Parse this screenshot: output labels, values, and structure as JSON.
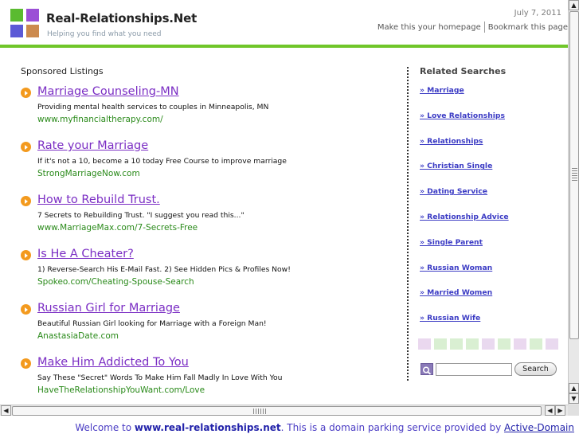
{
  "header": {
    "site_title": "Real-Relationships.Net",
    "tagline": "Helping you find what you need",
    "date": "July 7, 2011",
    "make_homepage": "Make this your homepage",
    "bookmark": "Bookmark this page"
  },
  "logo": {
    "colors": [
      "#5abb30",
      "#9b4fd6",
      "#5c5ad6",
      "#cc8a4e"
    ]
  },
  "sponsored": {
    "title": "Sponsored Listings",
    "items": [
      {
        "title": "Marriage Counseling-MN",
        "desc": "Providing mental health services to couples in Minneapolis, MN",
        "url": "www.myfinancialtherapy.com/"
      },
      {
        "title": "Rate your Marriage",
        "desc": "If it's not a 10, become a 10 today Free Course to improve marriage",
        "url": "StrongMarriageNow.com"
      },
      {
        "title": "How to Rebuild Trust.",
        "desc": "7 Secrets to Rebuilding Trust. \"I suggest you read this...\"",
        "url": "www.MarriageMax.com/7-Secrets-Free"
      },
      {
        "title": "Is He A Cheater?",
        "desc": "1) Reverse-Search His E-Mail Fast. 2) See Hidden Pics & Profiles Now!",
        "url": "Spokeo.com/Cheating-Spouse-Search"
      },
      {
        "title": "Russian Girl for Marriage",
        "desc": "Beautiful Russian Girl looking for Marriage with a Foreign Man!",
        "url": "AnastasiaDate.com"
      },
      {
        "title": "Make Him Addicted To You",
        "desc": "Say These \"Secret\" Words To Make Him Fall Madly In Love With You",
        "url": "HaveTheRelationshipYouWant.com/Love"
      }
    ]
  },
  "related": {
    "title": "Related Searches",
    "items": [
      "» Marriage",
      "» Love Relationships",
      "» Relationships",
      "» Christian Single",
      "» Dating Service",
      "» Relationship Advice",
      "» Single Parent",
      "» Russian Woman",
      "» Married Women",
      "» Russian Wife"
    ],
    "swatch_colors": [
      "#ead8ef",
      "#d9efd2",
      "#d9efd2",
      "#d9efd2",
      "#e9d9ef",
      "#d9efd2",
      "#ead8ef",
      "#d9efd2",
      "#e9d9ef"
    ]
  },
  "search": {
    "button_label": "Search",
    "value": ""
  },
  "scrollbars": {
    "up": "▲",
    "down": "▼",
    "left": "◀",
    "right": "▶"
  },
  "footer": {
    "prefix": "Welcome to ",
    "domain": "www.real-relationships.net",
    "middle": ". This is a domain parking service provided by ",
    "provider": "Active-Domain"
  },
  "colors": {
    "accent_green": "#70c62a",
    "link_purple": "#7b2ec4",
    "url_green": "#2a8a1a",
    "bullet_orange": "#f39a1e"
  }
}
